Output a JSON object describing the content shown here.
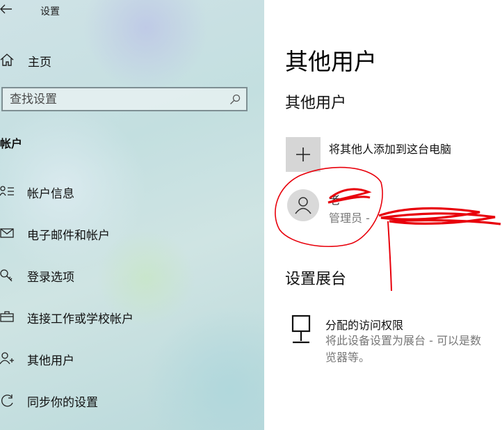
{
  "sidebar": {
    "app_title": "设置",
    "home_label": "主页",
    "search_placeholder": "查找设置",
    "section_heading": "帐户",
    "items": [
      {
        "label": "帐户信息",
        "icon": "account-info-icon"
      },
      {
        "label": "电子邮件和帐户",
        "icon": "mail-icon"
      },
      {
        "label": "登录选项",
        "icon": "key-icon"
      },
      {
        "label": "连接工作或学校帐户",
        "icon": "briefcase-icon"
      },
      {
        "label": "其他用户",
        "icon": "add-person-icon"
      },
      {
        "label": "同步你的设置",
        "icon": "sync-icon"
      }
    ]
  },
  "main": {
    "page_title": "其他用户",
    "other_users_heading": "其他用户",
    "add_user_label": "将其他人添加到这台电脑",
    "user": {
      "name": "老",
      "role": "管理员 - "
    },
    "kiosk_heading": "设置展台",
    "kiosk_title": "分配的访问权限",
    "kiosk_desc_line1": "将此设备设置为展台 - 可以是数",
    "kiosk_desc_line2": "览器等。"
  },
  "colors": {
    "annotation_red": "#e8000b",
    "tile_gray": "#d6d6d6",
    "secondary_text": "#777777"
  }
}
